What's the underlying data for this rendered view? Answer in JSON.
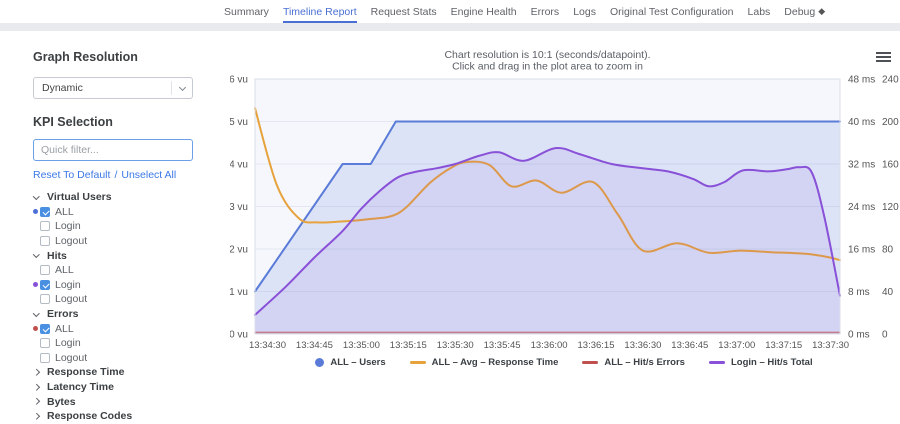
{
  "nav": {
    "tabs": [
      {
        "label": "Summary",
        "active": false
      },
      {
        "label": "Timeline Report",
        "active": true
      },
      {
        "label": "Request Stats",
        "active": false
      },
      {
        "label": "Engine Health",
        "active": false
      },
      {
        "label": "Errors",
        "active": false
      },
      {
        "label": "Logs",
        "active": false
      },
      {
        "label": "Original Test Configuration",
        "active": false
      },
      {
        "label": "Labs",
        "active": false
      },
      {
        "label": "Debug",
        "active": false,
        "icon": "gem-icon",
        "icon_glyph": "◆"
      }
    ]
  },
  "sidebar": {
    "graph_resolution_heading": "Graph Resolution",
    "resolution_value": "Dynamic",
    "kpi_heading": "KPI Selection",
    "filter_placeholder": "Quick filter...",
    "reset_link": "Reset To Default",
    "separator": "/",
    "unselect_link": "Unselect All",
    "tree": [
      {
        "label": "Virtual Users",
        "type": "group",
        "expanded": true
      },
      {
        "label": "ALL",
        "type": "item",
        "checked": true,
        "dot": "#4a6fd8"
      },
      {
        "label": "Login",
        "type": "item",
        "checked": false
      },
      {
        "label": "Logout",
        "type": "item",
        "checked": false
      },
      {
        "label": "Hits",
        "type": "group",
        "expanded": true
      },
      {
        "label": "ALL",
        "type": "item",
        "checked": false
      },
      {
        "label": "Login",
        "type": "item",
        "checked": true,
        "dot": "#8950d8"
      },
      {
        "label": "Logout",
        "type": "item",
        "checked": false
      },
      {
        "label": "Errors",
        "type": "group",
        "expanded": true
      },
      {
        "label": "ALL",
        "type": "item",
        "checked": true,
        "dot": "#c0504d"
      },
      {
        "label": "Login",
        "type": "item",
        "checked": false
      },
      {
        "label": "Logout",
        "type": "item",
        "checked": false
      },
      {
        "label": "Response Time",
        "type": "group",
        "expanded": false
      },
      {
        "label": "Latency Time",
        "type": "group",
        "expanded": false
      },
      {
        "label": "Bytes",
        "type": "group",
        "expanded": false
      },
      {
        "label": "Response Codes",
        "type": "group",
        "expanded": false
      }
    ]
  },
  "chart": {
    "title_line1": "Chart resolution is 10:1 (seconds/datapoint).",
    "title_line2": "Click and drag in the plot area to zoom in",
    "menu_icon": "hamburger-icon"
  },
  "chart_data": {
    "type": "line",
    "title": "Chart resolution is 10:1 (seconds/datapoint). Click and drag in the plot area to zoom in",
    "grid": "horizontal-only",
    "legend_position": "bottom",
    "time_start": "13:34:26",
    "time_domain_seconds": [
      0,
      187
    ],
    "x_ticks": [
      {
        "t": 4,
        "label": "13:34:30"
      },
      {
        "t": 19,
        "label": "13:34:45"
      },
      {
        "t": 34,
        "label": "13:35:00"
      },
      {
        "t": 49,
        "label": "13:35:15"
      },
      {
        "t": 64,
        "label": "13:35:30"
      },
      {
        "t": 79,
        "label": "13:35:45"
      },
      {
        "t": 94,
        "label": "13:36:00"
      },
      {
        "t": 109,
        "label": "13:36:15"
      },
      {
        "t": 124,
        "label": "13:36:30"
      },
      {
        "t": 139,
        "label": "13:36:45"
      },
      {
        "t": 154,
        "label": "13:37:00"
      },
      {
        "t": 169,
        "label": "13:37:15"
      },
      {
        "t": 184,
        "label": "13:37:30"
      }
    ],
    "axes": {
      "left": {
        "unit": "vu",
        "min": 0,
        "max": 6,
        "ticks": [
          "6 vu",
          "5 vu",
          "4 vu",
          "3 vu",
          "2 vu",
          "1 vu",
          "0 vu"
        ]
      },
      "right_ms": {
        "unit": "ms",
        "min": 0,
        "max": 48,
        "ticks": [
          "48 ms",
          "40 ms",
          "32 ms",
          "24 ms",
          "16 ms",
          "8 ms",
          "0 ms"
        ]
      },
      "right_count": {
        "unit": "count",
        "min": 0,
        "max": 240,
        "ticks": [
          "240",
          "200",
          "160",
          "120",
          "80",
          "40",
          "0"
        ]
      }
    },
    "series": [
      {
        "name": "ALL – Users",
        "axis": "vu",
        "color": "#5a7bd8",
        "fill": "rgba(90,123,216,0.16)",
        "symbol": "circle",
        "smooth": false,
        "width": 2,
        "points": [
          [
            0,
            1
          ],
          [
            28,
            4
          ],
          [
            37,
            4
          ],
          [
            45,
            5
          ],
          [
            187,
            5
          ]
        ]
      },
      {
        "name": "ALL – Avg – Response Time",
        "axis": "ms",
        "color": "#e6a23c",
        "fill": null,
        "symbol": "line",
        "smooth": true,
        "width": 2,
        "points": [
          [
            0,
            42.5
          ],
          [
            7,
            28
          ],
          [
            14,
            21.8
          ],
          [
            20,
            21.0
          ],
          [
            28,
            21.2
          ],
          [
            36,
            21.6
          ],
          [
            46,
            22.8
          ],
          [
            56,
            28.5
          ],
          [
            63,
            31.4
          ],
          [
            68,
            32.4
          ],
          [
            75,
            31.8
          ],
          [
            82,
            27.8
          ],
          [
            90,
            28.9
          ],
          [
            98,
            26.6
          ],
          [
            108,
            28.6
          ],
          [
            116,
            22.5
          ],
          [
            124,
            15.7
          ],
          [
            135,
            17.1
          ],
          [
            145,
            15.3
          ],
          [
            155,
            15.7
          ],
          [
            165,
            15.4
          ],
          [
            176,
            15.1
          ],
          [
            183,
            14.5
          ],
          [
            187,
            13.9
          ]
        ]
      },
      {
        "name": "ALL – Hit/s Errors",
        "axis": "count",
        "color": "#c0504d",
        "fill": null,
        "symbol": "line",
        "smooth": false,
        "width": 1.6,
        "opacity": 0.65,
        "points": [
          [
            0,
            1.5
          ],
          [
            187,
            1.5
          ]
        ]
      },
      {
        "name": "Login – Hit/s Total",
        "axis": "count",
        "color": "#8950d8",
        "fill": "rgba(137,80,216,0.10)",
        "symbol": "line",
        "smooth": true,
        "width": 2,
        "points": [
          [
            0,
            18
          ],
          [
            10,
            45
          ],
          [
            19,
            72
          ],
          [
            28,
            97
          ],
          [
            34,
            118
          ],
          [
            40,
            135
          ],
          [
            46,
            148
          ],
          [
            52,
            153
          ],
          [
            58,
            156
          ],
          [
            64,
            160
          ],
          [
            72,
            168
          ],
          [
            78,
            171
          ],
          [
            86,
            163
          ],
          [
            96,
            175
          ],
          [
            104,
            169
          ],
          [
            114,
            160
          ],
          [
            124,
            156
          ],
          [
            132,
            153
          ],
          [
            140,
            146
          ],
          [
            145,
            139
          ],
          [
            150,
            143
          ],
          [
            156,
            154
          ],
          [
            164,
            153
          ],
          [
            170,
            155
          ],
          [
            174,
            157
          ],
          [
            178,
            152
          ],
          [
            182,
            110
          ],
          [
            187,
            36
          ]
        ]
      }
    ]
  },
  "colors": {
    "accent_blue": "#4a6fd4",
    "checkbox_blue": "#4a90e2",
    "link_blue": "#3b78e7",
    "plot_bg": "#f6f7fc",
    "grid_line": "#e4e7f1"
  }
}
